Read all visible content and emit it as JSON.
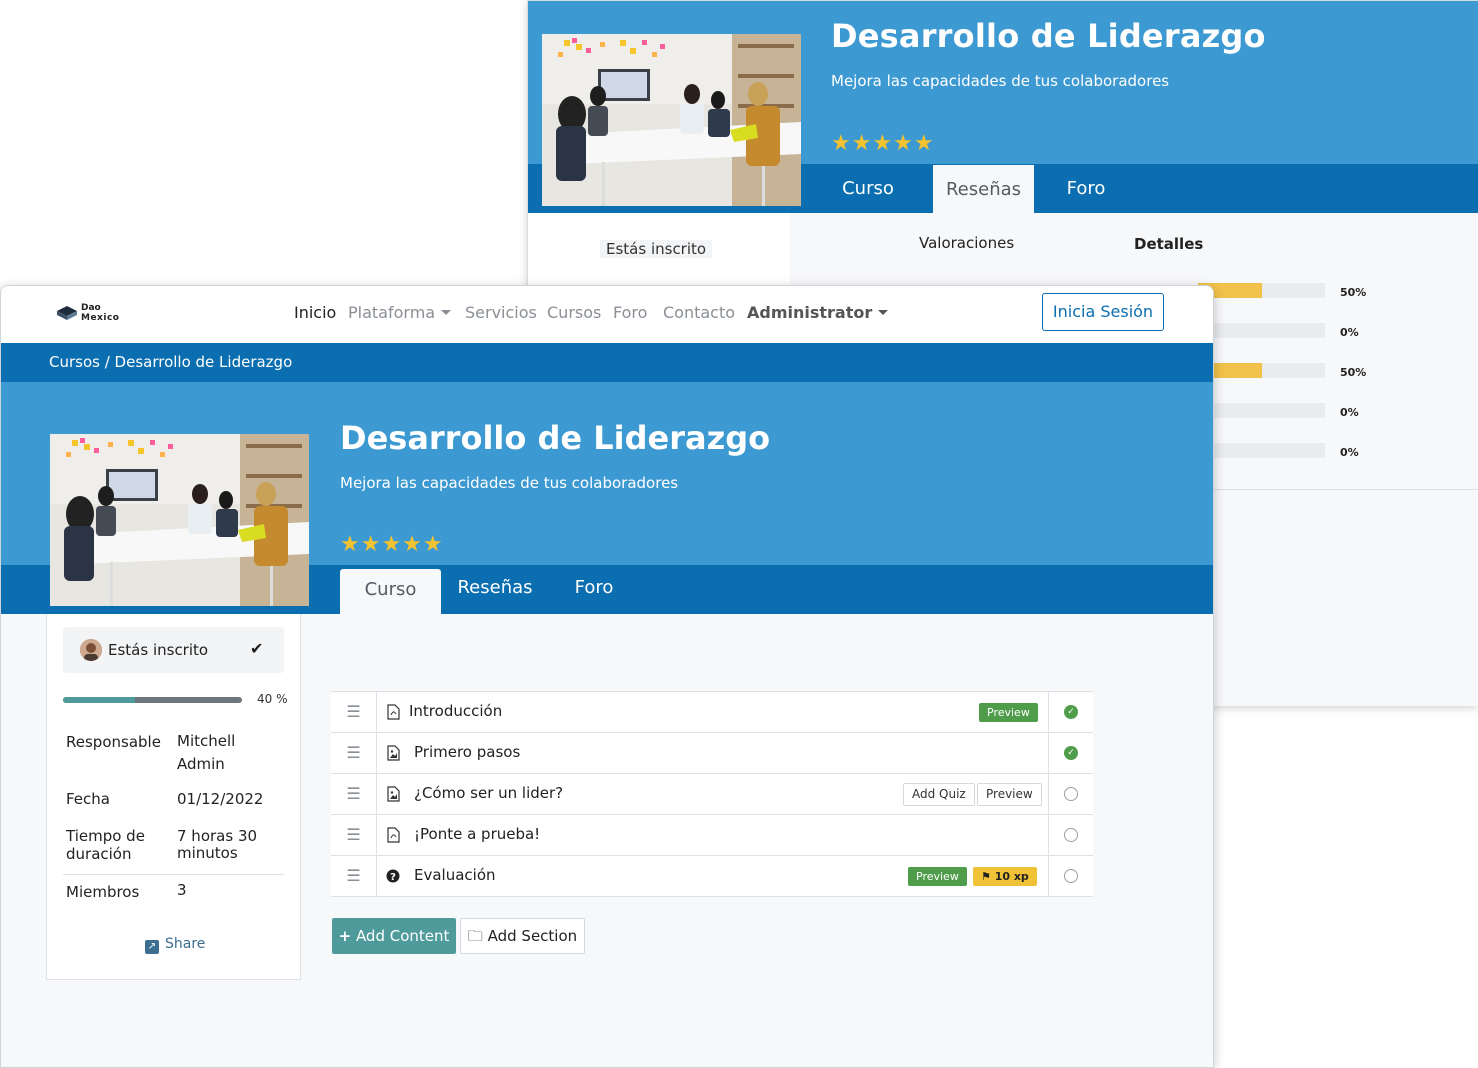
{
  "back_window": {
    "course_title": "Desarrollo de Liderazgo",
    "course_subtitle": "Mejora las capacidades de tus colaboradores",
    "stars": "★★★★★",
    "tabs": [
      {
        "label": "Curso"
      },
      {
        "label": "Reseñas"
      },
      {
        "label": "Foro"
      }
    ],
    "active_tab": "Reseñas",
    "enrolled_label": "Estás inscrito",
    "ratings_label": "Valoraciones",
    "details_label": "Detalles",
    "rating_bars": [
      {
        "value": 0.5,
        "label": "50%"
      },
      {
        "value": 0.0,
        "label": "0%"
      },
      {
        "value": 0.5,
        "label": "50%"
      },
      {
        "value": 0.0,
        "label": "0%"
      },
      {
        "value": 0.0,
        "label": "0%"
      }
    ],
    "colors": {
      "hero": "#3d99d1",
      "tabbar": "#0a6eb0",
      "bar_fill": "#f2c34a"
    }
  },
  "front_window": {
    "logo": {
      "line1": "Dao",
      "line2": "Mexico"
    },
    "nav": {
      "items": [
        "Inicio",
        "Plataforma",
        "Servicios",
        "Cursos",
        "Foro",
        "Contacto"
      ],
      "user_menu": "Administrator",
      "login_button": "Inicia Sesión"
    },
    "breadcrumb": "Cursos / Desarrollo de Liderazgo",
    "course_title": "Desarrollo de Liderazgo",
    "course_subtitle": "Mejora las capacidades de tus colaboradores",
    "stars": "★★★★★",
    "tabs": [
      {
        "label": "Curso"
      },
      {
        "label": "Reseñas"
      },
      {
        "label": "Foro"
      }
    ],
    "active_tab": "Curso",
    "sidebar": {
      "enrolled_label": "Estás inscrito",
      "check_icon": "✔",
      "progress": 0.4,
      "progress_label": "40 %",
      "info": [
        {
          "key": "Responsable",
          "value_line1": "Mitchell",
          "value_line2": "Admin"
        },
        {
          "key": "Fecha",
          "value_line1": "01/12/2022"
        },
        {
          "key_line1": "Tiempo de",
          "key_line2": "duración",
          "value_line1": "7 horas 30",
          "value_line2": "minutos"
        },
        {
          "key": "Miembros",
          "value_line1": "3"
        }
      ],
      "share_label": "Share"
    },
    "contents": [
      {
        "name": "Introducción",
        "type": "pdf-icon",
        "preview": "Preview",
        "done": true
      },
      {
        "name": "Primero pasos",
        "type": "image-icon",
        "done": true
      },
      {
        "name": "¿Cómo ser un lider?",
        "type": "image-icon",
        "add_quiz": "Add Quiz",
        "preview": "Preview",
        "done": false
      },
      {
        "name": "¡Ponte a prueba!",
        "type": "pdf-icon",
        "done": false
      },
      {
        "name": "Evaluación",
        "type": "question-icon",
        "preview": "Preview",
        "xp": "10 xp",
        "done": false
      }
    ],
    "buttons": {
      "add_content": "Add Content",
      "add_section": "Add Section"
    },
    "colors": {
      "hero": "#3d99d1",
      "tabbar": "#0a6eb0",
      "accent": "#4f9b9c",
      "done": "#4f9d4a"
    }
  }
}
